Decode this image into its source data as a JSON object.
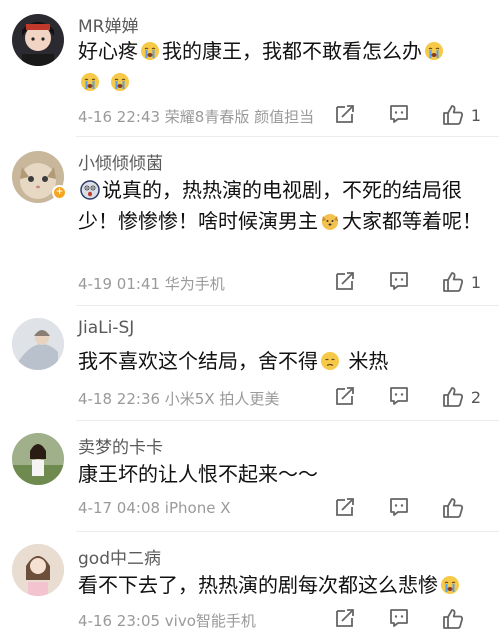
{
  "comments": [
    {
      "username": "MR婵婵",
      "text_parts": [
        "好心疼",
        "我的康王，我都不敢看怎么办",
        "",
        ""
      ],
      "emojis": [
        "crying-emoji",
        "crying-emoji",
        "crying-emoji",
        "crying-emoji"
      ],
      "meta": "4-16 22:43  荣耀8青春版 颜值担当",
      "likes": "1"
    },
    {
      "username": "小倾倾倾菌",
      "text_parts": [
        "说真的，热热演的电视剧，不死的结局很少！惨惨惨！啥时候演男主",
        "大家都等着呢！"
      ],
      "emojis": [
        "scared-emoji",
        "dog-emoji"
      ],
      "meta": "4-19 01:41  华为手机",
      "likes": "1",
      "badge": "+"
    },
    {
      "username": "JiaLi-SJ",
      "text_parts": [
        "我不喜欢这个结局，舍不得",
        " 米热"
      ],
      "emojis": [
        "sad-emoji"
      ],
      "meta": "4-18 22:36  小米5X 拍人更美",
      "likes": "2"
    },
    {
      "username": "卖梦的卡卡",
      "text_parts": [
        "康王坏的让人恨不起来～～"
      ],
      "meta": "4-17 04:08  iPhone X",
      "likes": ""
    },
    {
      "username": "god中二病",
      "text_parts": [
        "看不下去了，热热演的剧每次都这么悲惨"
      ],
      "emojis": [
        "crying-emoji"
      ],
      "meta": "4-16 23:05  vivo智能手机",
      "likes": ""
    }
  ],
  "icons": {
    "share": "share-icon",
    "comment": "comment-icon",
    "like": "thumbs-up-icon"
  },
  "colors": {
    "emoji_yellow": "#f7c948",
    "tear_blue": "#5aa0e6",
    "meta_gray": "#9a9a9a"
  }
}
